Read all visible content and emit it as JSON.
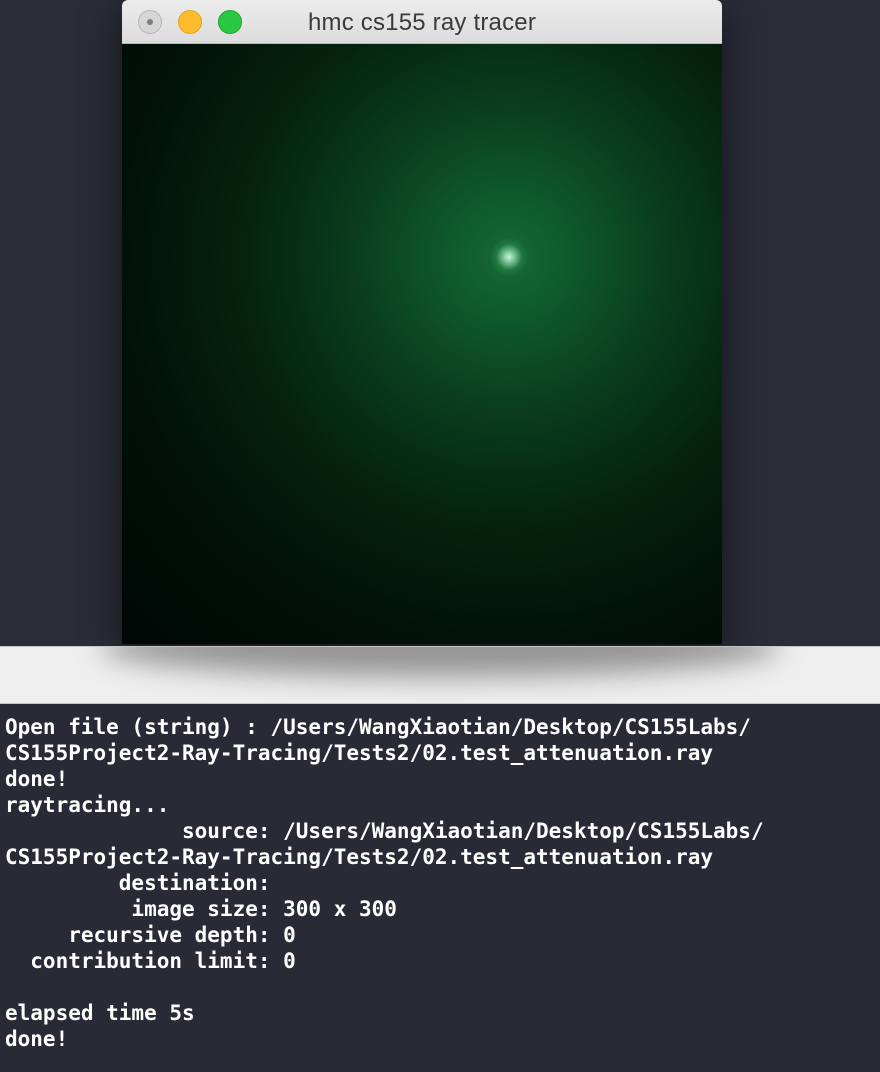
{
  "window": {
    "title": "hmc cs155 ray tracer",
    "traffic_lights": [
      "close-button",
      "minimize-button",
      "zoom-button"
    ]
  },
  "render": {
    "description_colors": {
      "background": "#000402",
      "glow": "#146a34",
      "highlight": "#d2ffe1"
    }
  },
  "console": {
    "lines": [
      "Open file (string) : /Users/WangXiaotian/Desktop/CS155Labs/",
      "CS155Project2-Ray-Tracing/Tests2/02.test_attenuation.ray",
      "done!",
      "raytracing...",
      "              source: /Users/WangXiaotian/Desktop/CS155Labs/",
      "CS155Project2-Ray-Tracing/Tests2/02.test_attenuation.ray",
      "         destination:",
      "          image size: 300 x 300",
      "     recursive depth: 0",
      "  contribution limit: 0",
      "",
      "elapsed time 5s",
      "done!"
    ]
  }
}
